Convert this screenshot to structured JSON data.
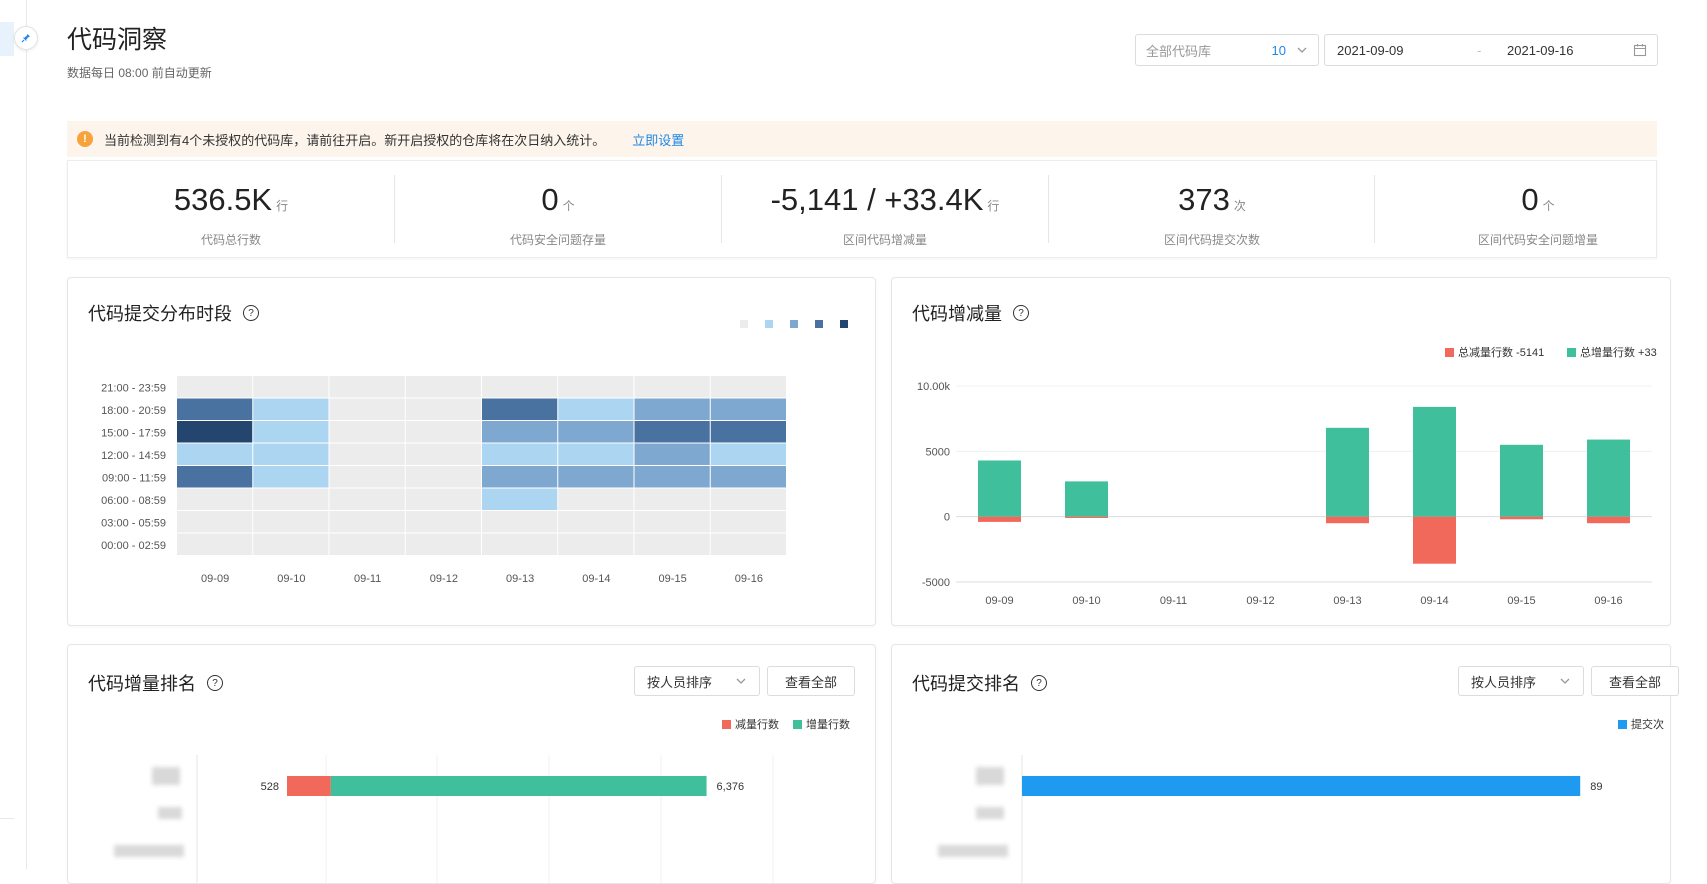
{
  "page": {
    "title": "代码洞察",
    "subtitle": "数据每日 08:00 前自动更新"
  },
  "filters": {
    "repo_placeholder": "全部代码库",
    "repo_count": "10",
    "date_start": "2021-09-09",
    "date_sep": "-",
    "date_end": "2021-09-16"
  },
  "alert": {
    "text": "当前检测到有4个未授权的代码库，请前往开启。新开启授权的仓库将在次日纳入统计。",
    "link": "立即设置"
  },
  "kpis": [
    {
      "value": "536.5K",
      "unit": "行",
      "label": "代码总行数"
    },
    {
      "value": "0",
      "unit": "个",
      "label": "代码安全问题存量"
    },
    {
      "value": "-5,141 / +33.4K",
      "unit": "行",
      "label": "区间代码增减量"
    },
    {
      "value": "373",
      "unit": "次",
      "label": "区间代码提交次数"
    },
    {
      "value": "0",
      "unit": "个",
      "label": "区间代码安全问题增量"
    }
  ],
  "colors": {
    "accent": "#1f88e5",
    "decrease": "#f0695a",
    "increase": "#40bf9c",
    "commit": "#1e9bf0",
    "heat_levels": [
      "#ececec",
      "#acd5f2",
      "#7fa8d1",
      "#4a72a0",
      "#24456e"
    ]
  },
  "heatmap_card": {
    "title": "代码提交分布时段",
    "help": "?",
    "chart_data": {
      "type": "heatmap",
      "x": [
        "09-09",
        "09-10",
        "09-11",
        "09-12",
        "09-13",
        "09-14",
        "09-15",
        "09-16"
      ],
      "y": [
        "21:00 - 23:59",
        "18:00 - 20:59",
        "15:00 - 17:59",
        "12:00 - 14:59",
        "09:00 - 11:59",
        "06:00 - 08:59",
        "03:00 - 05:59",
        "00:00 - 02:59"
      ],
      "levels": [
        [
          0,
          0,
          0,
          0,
          0,
          0,
          0,
          0
        ],
        [
          3,
          1,
          0,
          0,
          3,
          1,
          2,
          2
        ],
        [
          4,
          1,
          0,
          0,
          2,
          2,
          3,
          3
        ],
        [
          1,
          1,
          0,
          0,
          1,
          1,
          2,
          1
        ],
        [
          3,
          1,
          0,
          0,
          2,
          2,
          2,
          2
        ],
        [
          0,
          0,
          0,
          0,
          1,
          0,
          0,
          0
        ],
        [
          0,
          0,
          0,
          0,
          0,
          0,
          0,
          0
        ],
        [
          0,
          0,
          0,
          0,
          0,
          0,
          0,
          0
        ]
      ],
      "legend": "top-right"
    }
  },
  "change_card": {
    "title": "代码增减量",
    "help": "?",
    "legend_dec": "总减量行数 -5141",
    "legend_inc": "总增量行数 +33",
    "chart_data": {
      "type": "bar",
      "categories": [
        "09-09",
        "09-10",
        "09-11",
        "09-12",
        "09-13",
        "09-14",
        "09-15",
        "09-16"
      ],
      "series": [
        {
          "name": "总减量行数",
          "values": [
            -400,
            -100,
            0,
            0,
            -500,
            -3600,
            -200,
            -500
          ]
        },
        {
          "name": "总增量行数",
          "values": [
            4300,
            2700,
            0,
            0,
            6800,
            8400,
            5500,
            5900
          ]
        }
      ],
      "yticks": [
        "10.00k",
        "5000",
        "0",
        "-5000"
      ],
      "ytick_values": [
        10000,
        5000,
        0,
        -5000
      ],
      "ylim": [
        -5000,
        10000
      ],
      "stacked": true
    }
  },
  "increase_rank": {
    "title": "代码增量排名",
    "help": "?",
    "sort_label": "按人员排序",
    "view_all": "查看全部",
    "legend_dec": "减量行数",
    "legend_inc": "增量行数",
    "chart_data": {
      "type": "bar",
      "orientation": "horizontal",
      "series": [
        {
          "name": "减量行数",
          "values": [
            528
          ]
        },
        {
          "name": "增量行数",
          "values": [
            6376
          ]
        }
      ],
      "dec_label": "528",
      "inc_label": "6,376",
      "xlim": [
        0,
        7000
      ]
    }
  },
  "commit_rank": {
    "title": "代码提交排名",
    "help": "?",
    "sort_label": "按人员排序",
    "view_all": "查看全部",
    "legend": "提交次",
    "chart_data": {
      "type": "bar",
      "orientation": "horizontal",
      "series": [
        {
          "name": "提交次",
          "values": [
            89
          ]
        }
      ],
      "value_label": "89",
      "xlim": [
        0,
        100
      ]
    }
  },
  "icons": [
    "pin-icon",
    "chevron-down-icon",
    "calendar-icon",
    "warning-icon",
    "help-icon"
  ]
}
